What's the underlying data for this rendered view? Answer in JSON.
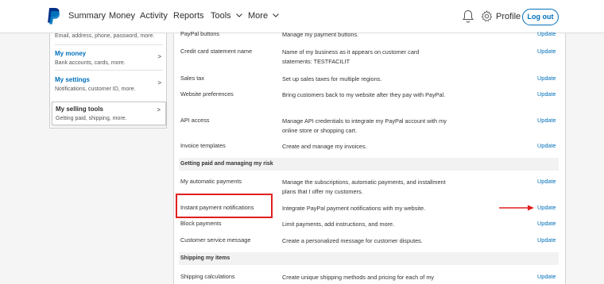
{
  "nav": {
    "logo_icon": "paypal-logo",
    "items": [
      "Summary",
      "Money",
      "Activity",
      "Reports",
      "Tools",
      "More"
    ],
    "profile": "Profile",
    "logout": "Log out"
  },
  "sidebar": {
    "top_subtitle": "Email, address, phone, password, more.",
    "items": [
      {
        "title": "My money",
        "subtitle": "Bank accounts, cards, more."
      },
      {
        "title": "My settings",
        "subtitle": "Notifications, customer ID, more."
      },
      {
        "title": "My selling tools",
        "subtitle": "Getting paid, shipping, more."
      }
    ]
  },
  "main": {
    "rows": [
      {
        "label": "PayPal buttons",
        "desc": "Manage my payment buttons.",
        "action": "Update"
      },
      {
        "label": "Credit card statement name",
        "desc": "Name of my business as it appears on customer card statements: TESTFACILIT",
        "action": "Update"
      },
      {
        "label": "Sales tax",
        "desc": "Set up sales taxes for multiple regions.",
        "action": "Update"
      },
      {
        "label": "Website preferences",
        "desc": "Bring customers back to my website after they pay with PayPal.",
        "action": "Update"
      },
      {
        "label": "API access",
        "desc": "Manage API credentials to integrate my PayPal account with my online store or shopping cart.",
        "action": "Update"
      },
      {
        "label": "Invoice templates",
        "desc": "Create and manage my invoices.",
        "action": "Update"
      }
    ],
    "section_getting_paid": "Getting paid and managing my risk",
    "risk_rows": [
      {
        "label": "My automatic payments",
        "desc": "Manage the subscriptions, automatic payments, and installment plans that I offer my customers.",
        "action": "Update"
      },
      {
        "label": "Instant payment notifications",
        "desc": "Integrate PayPal payment notifications with my website.",
        "action": "Update"
      },
      {
        "label": "Block payments",
        "desc": "Limit payments, add instructions, and more.",
        "action": "Update"
      },
      {
        "label": "Customer service message",
        "desc": "Create a personalized message for customer disputes.",
        "action": "Update"
      }
    ],
    "section_shipping": "Shipping my items",
    "shipping_rows": [
      {
        "label": "Shipping calculations",
        "desc": "Create unique shipping methods and pricing for each of my",
        "action": "Update"
      }
    ]
  },
  "colors": {
    "accent": "#0070ba",
    "highlight": "#e02020"
  }
}
